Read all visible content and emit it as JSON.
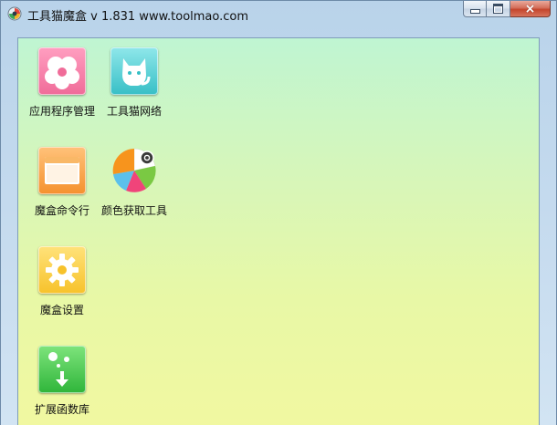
{
  "window": {
    "title": "工具猫魔盒 v 1.831 www.toolmao.com",
    "controls": {
      "minimize": "minimize",
      "maximize": "maximize",
      "close": "×"
    }
  },
  "tiles": [
    {
      "label": "应用程序管理",
      "icon": "flower-icon",
      "color": "#f06c99"
    },
    {
      "label": "工具猫网络",
      "icon": "cat-icon",
      "color": "#37bfc6"
    },
    {
      "label": "魔盒命令行",
      "icon": "console-window-icon",
      "color": "#f5912e"
    },
    {
      "label": "颜色获取工具",
      "icon": "color-pie-icon",
      "color": "#8ac926"
    },
    {
      "label": "魔盒设置",
      "icon": "gear-icon",
      "color": "#f7c22b"
    },
    {
      "label": "扩展函数库",
      "icon": "download-bubbles-icon",
      "color": "#2fb53a"
    }
  ]
}
